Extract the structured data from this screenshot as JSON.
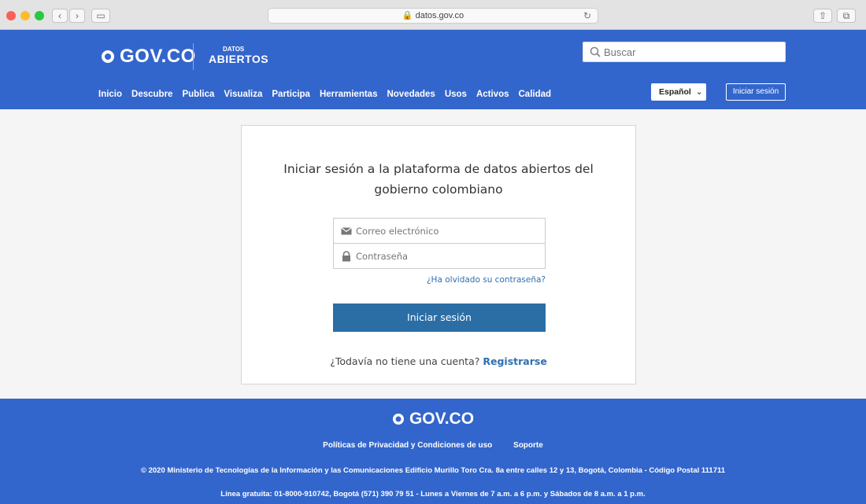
{
  "browser": {
    "url": "datos.gov.co"
  },
  "header": {
    "gov_logo": "GOV.CO",
    "datos_small": "DATOS",
    "datos_big": "ABIERTOS",
    "search_placeholder": "Buscar",
    "nav": [
      "Inicio",
      "Descubre",
      "Publica",
      "Visualiza",
      "Participa",
      "Herramientas",
      "Novedades",
      "Usos",
      "Activos",
      "Calidad"
    ],
    "language": "Español",
    "login_button": "Iniciar sesión"
  },
  "login_card": {
    "title_line1": "Iniciar sesión a la plataforma de datos abiertos del",
    "title_line2": "gobierno colombiano",
    "email_placeholder": "Correo electrónico",
    "password_placeholder": "Contraseña",
    "forgot_link": "¿Ha olvidado su contraseña?",
    "submit_label": "Iniciar sesión",
    "register_prompt": "¿Todavía no tiene una cuenta?",
    "register_link": "Registrarse"
  },
  "footer": {
    "logo": "GOV.CO",
    "link_privacy": "Políticas de Privacidad y Condiciones de uso",
    "link_support": "Soporte",
    "copyright": "© 2020 Ministerio de Tecnologías de la Información y las Comunicaciones Edificio Murillo Toro Cra. 8a entre calles 12 y 13, Bogotá, Colombia - Código Postal 111711",
    "phone_line": "Línea gratuita: 01-8000-910742, Bogotá (571) 390 79 51 - Lunes a Viernes de 7 a.m. a 6 p.m. y Sábados de 8 a.m. a 1 p.m."
  },
  "colors": {
    "brand_blue": "#3366cc",
    "button_blue": "#2b6ea5",
    "link_blue": "#2f6fb0"
  }
}
